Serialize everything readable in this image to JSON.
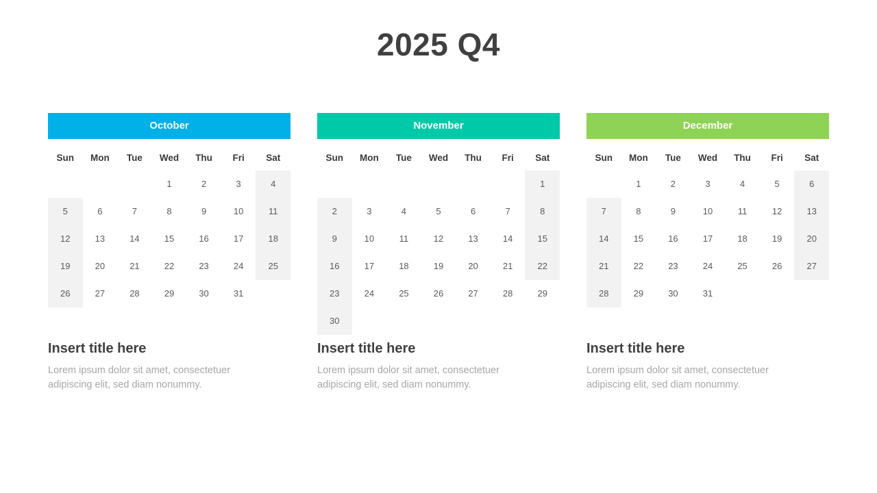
{
  "slide": {
    "title": "2025 Q4",
    "title_color": "#404040",
    "background": "#ffffff"
  },
  "weekdays": [
    "Sun",
    "Mon",
    "Tue",
    "Wed",
    "Thu",
    "Fri",
    "Sat"
  ],
  "months": [
    {
      "name": "October",
      "accent_color": "#00b0e6",
      "start_weekday_index": 3,
      "days_in_month": 31,
      "weeks": [
        [
          "",
          "",
          "",
          "1",
          "2",
          "3",
          "4"
        ],
        [
          "5",
          "6",
          "7",
          "8",
          "9",
          "10",
          "11"
        ],
        [
          "12",
          "13",
          "14",
          "15",
          "16",
          "17",
          "18"
        ],
        [
          "19",
          "20",
          "21",
          "22",
          "23",
          "24",
          "25"
        ],
        [
          "26",
          "27",
          "28",
          "29",
          "30",
          "31",
          ""
        ]
      ],
      "shaded_cells": [
        [
          false,
          false,
          false,
          false,
          false,
          false,
          true
        ],
        [
          true,
          false,
          false,
          false,
          false,
          false,
          true
        ],
        [
          true,
          false,
          false,
          false,
          false,
          false,
          true
        ],
        [
          true,
          false,
          false,
          false,
          false,
          false,
          true
        ],
        [
          true,
          false,
          false,
          false,
          false,
          false,
          false
        ]
      ]
    },
    {
      "name": "November",
      "accent_color": "#00c9a7",
      "start_weekday_index": 6,
      "days_in_month": 30,
      "weeks": [
        [
          "",
          "",
          "",
          "",
          "",
          "",
          "1"
        ],
        [
          "2",
          "3",
          "4",
          "5",
          "6",
          "7",
          "8"
        ],
        [
          "9",
          "10",
          "11",
          "12",
          "13",
          "14",
          "15"
        ],
        [
          "16",
          "17",
          "18",
          "19",
          "20",
          "21",
          "22"
        ],
        [
          "23",
          "24",
          "25",
          "26",
          "27",
          "28",
          "29"
        ],
        [
          "30",
          "",
          "",
          "",
          "",
          "",
          ""
        ]
      ],
      "shaded_cells": [
        [
          false,
          false,
          false,
          false,
          false,
          false,
          true
        ],
        [
          true,
          false,
          false,
          false,
          false,
          false,
          true
        ],
        [
          true,
          false,
          false,
          false,
          false,
          false,
          true
        ],
        [
          true,
          false,
          false,
          false,
          false,
          false,
          true
        ],
        [
          true,
          false,
          false,
          false,
          false,
          false,
          false
        ],
        [
          true,
          false,
          false,
          false,
          false,
          false,
          false
        ]
      ]
    },
    {
      "name": "December",
      "accent_color": "#8ed355",
      "start_weekday_index": 1,
      "days_in_month": 31,
      "weeks": [
        [
          "",
          "1",
          "2",
          "3",
          "4",
          "5",
          "6"
        ],
        [
          "7",
          "8",
          "9",
          "10",
          "11",
          "12",
          "13"
        ],
        [
          "14",
          "15",
          "16",
          "17",
          "18",
          "19",
          "20"
        ],
        [
          "21",
          "22",
          "23",
          "24",
          "25",
          "26",
          "27"
        ],
        [
          "28",
          "29",
          "30",
          "31",
          "",
          "",
          ""
        ]
      ],
      "shaded_cells": [
        [
          false,
          false,
          false,
          false,
          false,
          false,
          true
        ],
        [
          true,
          false,
          false,
          false,
          false,
          false,
          true
        ],
        [
          true,
          false,
          false,
          false,
          false,
          false,
          true
        ],
        [
          true,
          false,
          false,
          false,
          false,
          false,
          true
        ],
        [
          true,
          false,
          false,
          false,
          false,
          false,
          false
        ]
      ]
    }
  ],
  "text_blocks": [
    {
      "title": "Insert title here",
      "body": "Lorem ipsum dolor sit amet, consectetuer adipiscing elit, sed diam nonummy."
    },
    {
      "title": "Insert title here",
      "body": "Lorem ipsum dolor sit amet, consectetuer adipiscing elit, sed diam nonummy."
    },
    {
      "title": "Insert title here",
      "body": "Lorem ipsum dolor sit amet, consectetuer adipiscing elit, sed diam nonummy."
    }
  ]
}
